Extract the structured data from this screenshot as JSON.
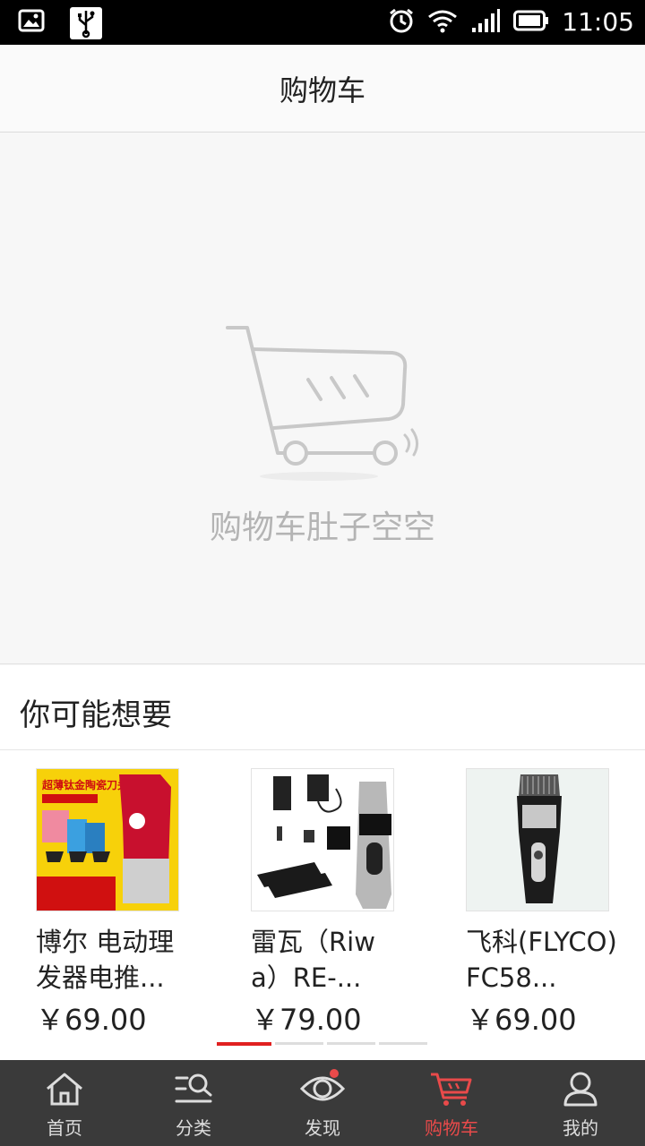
{
  "status_bar": {
    "time": "11:05"
  },
  "header": {
    "title": "购物车"
  },
  "empty_cart": {
    "message": "购物车肚子空空"
  },
  "recommend": {
    "title": "你可能想要",
    "products": [
      {
        "name": "博尔 电动理发器电推...",
        "price": "￥69.00",
        "image_caption": "超薄钛金陶瓷刀头"
      },
      {
        "name": "雷瓦（Riwa）RE-...",
        "price": "￥79.00"
      },
      {
        "name": "飞科(FLYCO)FC58...",
        "price": "￥69.00"
      }
    ],
    "pager": {
      "count": 4,
      "active_index": 0
    }
  },
  "tabbar": {
    "items": [
      {
        "label": "首页",
        "icon": "home-icon"
      },
      {
        "label": "分类",
        "icon": "category-search-icon"
      },
      {
        "label": "发现",
        "icon": "eye-icon"
      },
      {
        "label": "购物车",
        "icon": "cart-icon",
        "active": true
      },
      {
        "label": "我的",
        "icon": "user-icon"
      }
    ]
  },
  "colors": {
    "accent": "#e94a4a",
    "tabbar_bg": "#3a3a3a"
  }
}
